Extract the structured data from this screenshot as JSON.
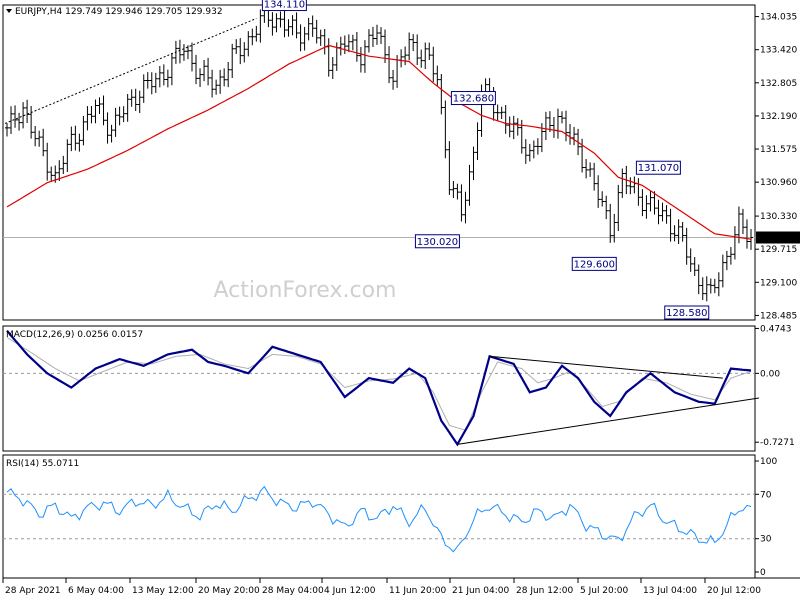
{
  "chart_data": [
    {
      "type": "candlestick",
      "header": {
        "symbol": "EURJPY,H4",
        "open": "129.749",
        "high": "129.946",
        "low": "129.705",
        "close": "129.932"
      },
      "watermark": "ActionForex.com",
      "current_price_label": "129.932",
      "ylim": [
        128.4,
        134.25
      ],
      "y_ticks": [
        "134.035",
        "133.420",
        "132.805",
        "132.190",
        "131.575",
        "130.960",
        "130.330",
        "129.715",
        "129.100",
        "128.485"
      ],
      "x_ticks": [
        "28 Apr 2021",
        "6 May 04:00",
        "13 May 12:00",
        "20 May 20:00",
        "28 May 04:00",
        "4 Jun 12:00",
        "11 Jun 20:00",
        "21 Jun 04:00",
        "28 Jun 12:00",
        "5 Jul 20:00",
        "13 Jul 04:00",
        "20 Jul 12:00"
      ],
      "bar_count": 186,
      "price_path": [
        [
          0,
          131.9
        ],
        [
          4,
          132.35
        ],
        [
          8,
          131.6
        ],
        [
          12,
          131.05
        ],
        [
          16,
          131.7
        ],
        [
          22,
          132.35
        ],
        [
          26,
          131.95
        ],
        [
          32,
          132.6
        ],
        [
          38,
          132.9
        ],
        [
          44,
          133.45
        ],
        [
          48,
          132.95
        ],
        [
          52,
          132.75
        ],
        [
          56,
          133.25
        ],
        [
          60,
          133.6
        ],
        [
          64,
          134.05
        ],
        [
          68,
          133.95
        ],
        [
          72,
          133.7
        ],
        [
          76,
          133.85
        ],
        [
          80,
          133.2
        ],
        [
          84,
          133.55
        ],
        [
          88,
          133.35
        ],
        [
          92,
          133.75
        ],
        [
          96,
          132.9
        ],
        [
          100,
          133.55
        ],
        [
          104,
          133.3
        ],
        [
          107,
          132.9
        ],
        [
          110,
          131.0
        ],
        [
          113,
          130.35
        ],
        [
          116,
          131.5
        ],
        [
          118,
          132.65
        ],
        [
          122,
          132.3
        ],
        [
          126,
          131.9
        ],
        [
          130,
          131.5
        ],
        [
          134,
          131.95
        ],
        [
          137,
          132.2
        ],
        [
          140,
          131.8
        ],
        [
          144,
          131.3
        ],
        [
          147,
          130.7
        ],
        [
          150,
          130.1
        ],
        [
          153,
          131.0
        ],
        [
          156,
          130.8
        ],
        [
          160,
          130.5
        ],
        [
          164,
          130.3
        ],
        [
          168,
          129.85
        ],
        [
          171,
          129.25
        ],
        [
          175,
          128.85
        ],
        [
          179,
          129.6
        ],
        [
          182,
          130.15
        ],
        [
          185,
          129.93
        ]
      ],
      "ma": [
        [
          0,
          130.5
        ],
        [
          10,
          130.95
        ],
        [
          20,
          131.2
        ],
        [
          30,
          131.55
        ],
        [
          40,
          131.95
        ],
        [
          50,
          132.3
        ],
        [
          60,
          132.7
        ],
        [
          70,
          133.15
        ],
        [
          80,
          133.5
        ],
        [
          90,
          133.3
        ],
        [
          100,
          133.2
        ],
        [
          106,
          132.8
        ],
        [
          112,
          132.45
        ],
        [
          118,
          132.2
        ],
        [
          124,
          132.05
        ],
        [
          130,
          132.0
        ],
        [
          138,
          131.9
        ],
        [
          146,
          131.5
        ],
        [
          152,
          131.05
        ],
        [
          158,
          130.9
        ],
        [
          164,
          130.6
        ],
        [
          170,
          130.3
        ],
        [
          176,
          130.0
        ],
        [
          185,
          129.9
        ]
      ],
      "annotations": [
        {
          "label": "134.110",
          "bar": 64,
          "price": 134.11,
          "side": "left",
          "pos": "above"
        },
        {
          "label": "132.680",
          "bar": 111,
          "price": 132.68,
          "side": "left",
          "pos": "below"
        },
        {
          "label": "130.020",
          "bar": 112,
          "price": 130.02,
          "side": "right",
          "pos": "below"
        },
        {
          "label": "131.070",
          "bar": 157,
          "price": 131.07,
          "side": "left",
          "pos": "above"
        },
        {
          "label": "129.600",
          "bar": 151,
          "price": 129.6,
          "side": "right",
          "pos": "below"
        },
        {
          "label": "128.580",
          "bar": 174,
          "price": 128.58,
          "side": "right",
          "pos": "below"
        }
      ]
    },
    {
      "type": "line",
      "name": "MACD",
      "header": "MACD(12,26,9) 0.0256 0.0157",
      "ylim": [
        -0.82,
        0.5
      ],
      "y_ticks": [
        "0.4743",
        "0.00",
        "-0.7271"
      ],
      "main_path": [
        [
          0,
          0.45
        ],
        [
          5,
          0.2
        ],
        [
          10,
          0.0
        ],
        [
          16,
          -0.15
        ],
        [
          22,
          0.05
        ],
        [
          28,
          0.15
        ],
        [
          34,
          0.08
        ],
        [
          40,
          0.2
        ],
        [
          46,
          0.25
        ],
        [
          50,
          0.12
        ],
        [
          54,
          0.08
        ],
        [
          60,
          0.0
        ],
        [
          66,
          0.28
        ],
        [
          72,
          0.2
        ],
        [
          78,
          0.12
        ],
        [
          84,
          -0.25
        ],
        [
          90,
          -0.05
        ],
        [
          96,
          -0.1
        ],
        [
          100,
          0.05
        ],
        [
          104,
          -0.05
        ],
        [
          108,
          -0.5
        ],
        [
          112,
          -0.75
        ],
        [
          116,
          -0.45
        ],
        [
          120,
          0.18
        ],
        [
          126,
          0.1
        ],
        [
          130,
          -0.2
        ],
        [
          134,
          -0.15
        ],
        [
          138,
          0.08
        ],
        [
          142,
          -0.05
        ],
        [
          146,
          -0.3
        ],
        [
          150,
          -0.45
        ],
        [
          154,
          -0.2
        ],
        [
          160,
          0.0
        ],
        [
          166,
          -0.2
        ],
        [
          172,
          -0.3
        ],
        [
          176,
          -0.32
        ],
        [
          180,
          0.05
        ],
        [
          185,
          0.03
        ]
      ],
      "signal_path": [
        [
          0,
          0.38
        ],
        [
          6,
          0.22
        ],
        [
          12,
          0.05
        ],
        [
          18,
          -0.08
        ],
        [
          24,
          0.02
        ],
        [
          30,
          0.12
        ],
        [
          36,
          0.1
        ],
        [
          42,
          0.18
        ],
        [
          48,
          0.2
        ],
        [
          54,
          0.1
        ],
        [
          60,
          0.05
        ],
        [
          66,
          0.2
        ],
        [
          72,
          0.18
        ],
        [
          78,
          0.1
        ],
        [
          84,
          -0.15
        ],
        [
          90,
          -0.08
        ],
        [
          96,
          -0.06
        ],
        [
          102,
          0.0
        ],
        [
          106,
          -0.2
        ],
        [
          110,
          -0.55
        ],
        [
          114,
          -0.6
        ],
        [
          118,
          -0.2
        ],
        [
          122,
          0.12
        ],
        [
          128,
          0.05
        ],
        [
          132,
          -0.1
        ],
        [
          136,
          -0.05
        ],
        [
          140,
          0.02
        ],
        [
          144,
          -0.15
        ],
        [
          148,
          -0.35
        ],
        [
          152,
          -0.3
        ],
        [
          158,
          -0.05
        ],
        [
          164,
          -0.1
        ],
        [
          170,
          -0.22
        ],
        [
          176,
          -0.28
        ],
        [
          180,
          -0.05
        ],
        [
          185,
          0.02
        ]
      ],
      "trendlines": [
        {
          "from": [
            112,
            -0.75
          ],
          "to": [
            185,
            -0.26
          ]
        },
        {
          "from": [
            120,
            0.18
          ],
          "to": [
            176,
            -0.05
          ]
        }
      ]
    },
    {
      "type": "line",
      "name": "RSI",
      "header": "RSI(14) 55.0711",
      "ylim": [
        0,
        100
      ],
      "y_ticks": [
        "100",
        "70",
        "30",
        "0"
      ],
      "levels": [
        70,
        30
      ],
      "path": [
        [
          0,
          72
        ],
        [
          4,
          65
        ],
        [
          8,
          52
        ],
        [
          12,
          60
        ],
        [
          16,
          48
        ],
        [
          20,
          58
        ],
        [
          24,
          62
        ],
        [
          28,
          55
        ],
        [
          32,
          64
        ],
        [
          36,
          60
        ],
        [
          40,
          68
        ],
        [
          44,
          58
        ],
        [
          48,
          50
        ],
        [
          52,
          62
        ],
        [
          56,
          55
        ],
        [
          60,
          66
        ],
        [
          64,
          73
        ],
        [
          68,
          62
        ],
        [
          72,
          58
        ],
        [
          76,
          64
        ],
        [
          80,
          52
        ],
        [
          84,
          40
        ],
        [
          88,
          55
        ],
        [
          92,
          48
        ],
        [
          96,
          60
        ],
        [
          100,
          45
        ],
        [
          104,
          58
        ],
        [
          108,
          30
        ],
        [
          112,
          18
        ],
        [
          116,
          48
        ],
        [
          120,
          60
        ],
        [
          124,
          52
        ],
        [
          128,
          45
        ],
        [
          132,
          55
        ],
        [
          136,
          48
        ],
        [
          140,
          60
        ],
        [
          144,
          42
        ],
        [
          148,
          34
        ],
        [
          152,
          28
        ],
        [
          156,
          50
        ],
        [
          160,
          60
        ],
        [
          164,
          45
        ],
        [
          168,
          38
        ],
        [
          172,
          30
        ],
        [
          176,
          26
        ],
        [
          180,
          48
        ],
        [
          183,
          60
        ],
        [
          185,
          55
        ]
      ]
    }
  ]
}
